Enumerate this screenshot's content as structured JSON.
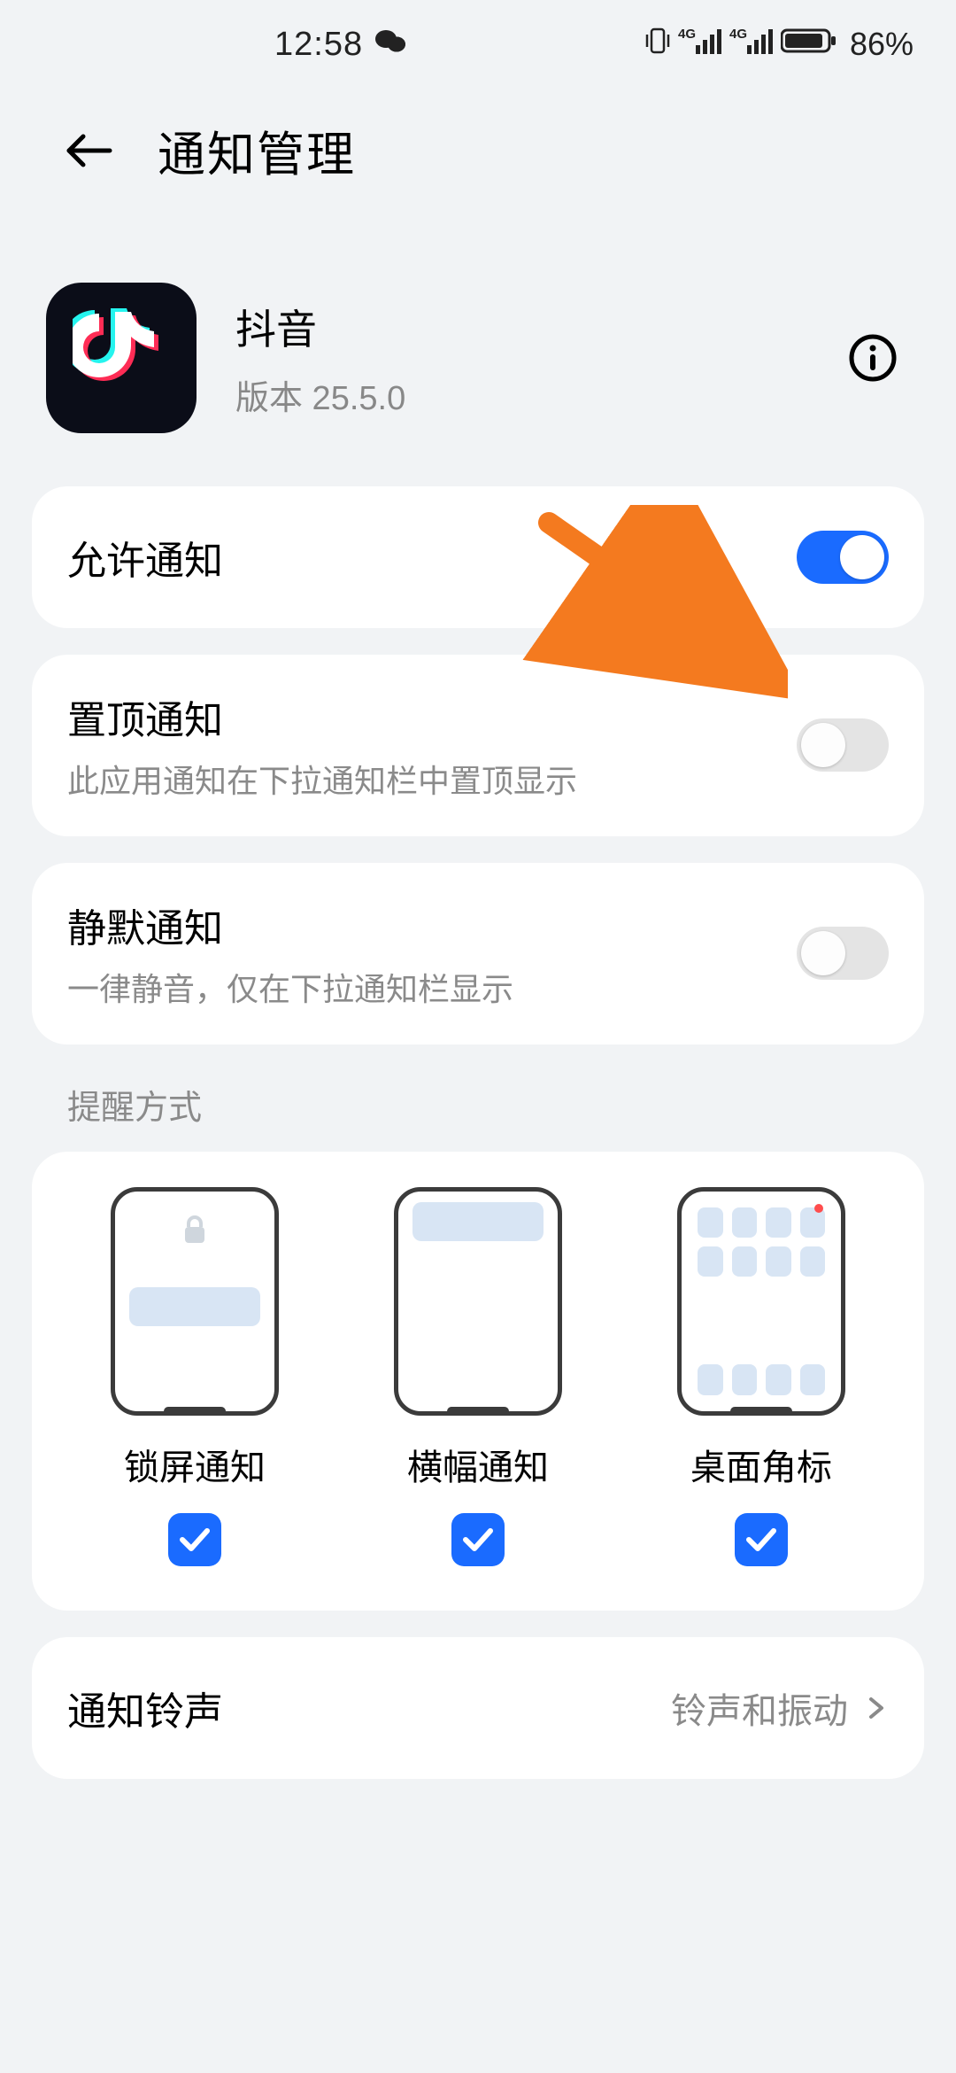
{
  "status": {
    "time": "12:58",
    "battery_pct": "86%"
  },
  "header": {
    "title": "通知管理"
  },
  "app": {
    "name": "抖音",
    "version_label": "版本 25.5.0"
  },
  "allow": {
    "title": "允许通知",
    "on": true
  },
  "pin": {
    "title": "置顶通知",
    "sub": "此应用通知在下拉通知栏中置顶显示",
    "on": false
  },
  "silent": {
    "title": "静默通知",
    "sub": "一律静音，仅在下拉通知栏显示",
    "on": false
  },
  "modes": {
    "heading": "提醒方式",
    "items": [
      {
        "label": "锁屏通知",
        "checked": true
      },
      {
        "label": "横幅通知",
        "checked": true
      },
      {
        "label": "桌面角标",
        "checked": true
      }
    ]
  },
  "ringtone": {
    "title": "通知铃声",
    "value": "铃声和振动"
  },
  "colors": {
    "accent": "#1a6bff",
    "annotation": "#f47a1f"
  }
}
